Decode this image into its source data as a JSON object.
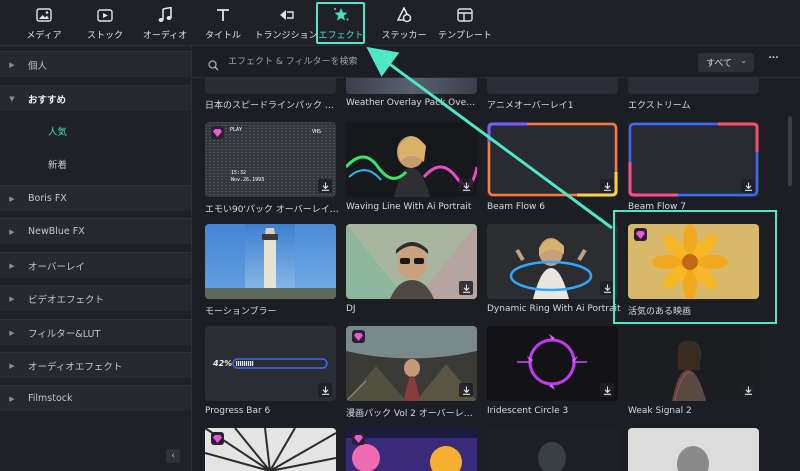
{
  "toolbar": {
    "items": [
      {
        "label": "メディア",
        "icon": "media-icon"
      },
      {
        "label": "ストック",
        "icon": "stock-icon"
      },
      {
        "label": "オーディオ",
        "icon": "music-note-icon"
      },
      {
        "label": "タイトル",
        "icon": "title-t-icon"
      },
      {
        "label": "トランジション",
        "icon": "transition-icon"
      },
      {
        "label": "エフェクト",
        "icon": "effects-star-icon",
        "active": true
      },
      {
        "label": "ステッカー",
        "icon": "sticker-icon"
      },
      {
        "label": "テンプレート",
        "icon": "template-icon"
      }
    ]
  },
  "sidebar": {
    "items": [
      {
        "label": "個人",
        "type": "category"
      },
      {
        "label": "おすすめ",
        "type": "category-open"
      },
      {
        "label": "人気",
        "type": "sub",
        "selected": true
      },
      {
        "label": "新着",
        "type": "sub"
      },
      {
        "label": "Boris FX",
        "type": "category"
      },
      {
        "label": "NewBlue FX",
        "type": "category"
      },
      {
        "label": "オーバーレイ",
        "type": "category"
      },
      {
        "label": "ビデオエフェクト",
        "type": "category"
      },
      {
        "label": "フィルター&LUT",
        "type": "category"
      },
      {
        "label": "オーディオエフェクト",
        "type": "category"
      },
      {
        "label": "Filmstock",
        "type": "category"
      }
    ]
  },
  "search": {
    "placeholder": "エフェクト & フィルターを検索",
    "filter_value": "すべて"
  },
  "grid": {
    "row0_captions": [
      "日本のスピードラインパック オー…",
      "Weather Overlay Pack Overl…",
      "アニメオーバーレイ1",
      "エクストリーム"
    ],
    "cards": [
      {
        "caption": "エモい90'パック オーバーレイ 01",
        "thumb": "vhs",
        "vhs_play": "PLAY",
        "vhs_label": "VHS",
        "vhs_time": "15:32",
        "vhs_date": "Nov.26.1993",
        "premium": true,
        "download": true
      },
      {
        "caption": "Waving Line With Ai Portrait",
        "thumb": "wave",
        "download": true
      },
      {
        "caption": "Beam Flow 6",
        "thumb": "beam6",
        "download": true
      },
      {
        "caption": "Beam Flow 7",
        "thumb": "beam7",
        "download": true
      },
      {
        "caption": "モーションブラー",
        "thumb": "lighthouse"
      },
      {
        "caption": "DJ",
        "thumb": "dj",
        "download": true
      },
      {
        "caption": "Dynamic Ring With Ai Portrait",
        "thumb": "ring",
        "download": true
      },
      {
        "caption": "活気のある映画",
        "thumb": "flower",
        "premium": true
      },
      {
        "caption": "Progress Bar 6",
        "thumb": "progress",
        "progress_text": "42%",
        "download": true
      },
      {
        "caption": "漫画パック Vol 2 オーバーレイ 03",
        "thumb": "manga",
        "premium": true,
        "download": true
      },
      {
        "caption": "Iridescent Circle 3",
        "thumb": "circle",
        "download": true
      },
      {
        "caption": "Weak Signal 2",
        "thumb": "signal",
        "download": true
      }
    ]
  },
  "colors": {
    "accent": "#4ee7c8",
    "background": "#1c1e23",
    "sidebar": "#1f2126"
  }
}
